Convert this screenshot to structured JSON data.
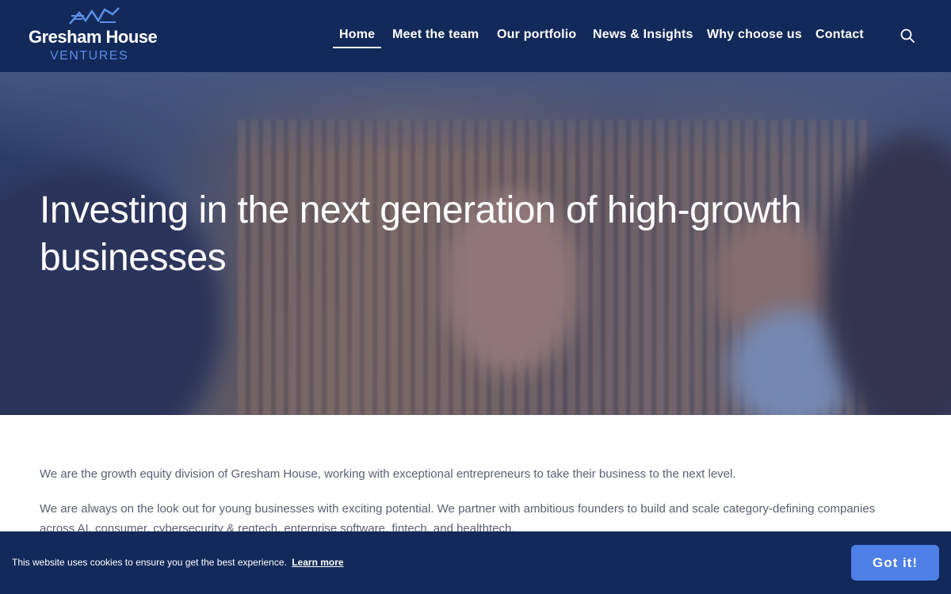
{
  "header": {
    "logo_brand": "Gresham House",
    "logo_sub": "VENTURES",
    "nav": [
      {
        "label": "Home",
        "active": true
      },
      {
        "label": "Meet the team"
      },
      {
        "label": "Our portfolio"
      },
      {
        "label": "News & Insights"
      },
      {
        "label": "Why choose us"
      },
      {
        "label": "Contact"
      }
    ],
    "search_icon": "search-icon"
  },
  "hero": {
    "title": "Investing in the next generation of high-growth businesses"
  },
  "intro": {
    "p1": "We are the growth equity division of Gresham House, working with exceptional entrepreneurs to take their business to the next level.",
    "p2": "We are always on the look out for young businesses with exciting potential. We partner with ambitious founders to build and scale category-defining companies across AI, consumer, cybersecurity & regtech, enterprise software, fintech, and healthtech."
  },
  "cookie": {
    "text": "This website uses cookies to ensure you get the best experience.",
    "link": "Learn more",
    "button": "Got it!"
  },
  "colors": {
    "header_bg": "#13295a",
    "accent": "#4d7fe6",
    "logo_sub": "#5b8ee8"
  }
}
